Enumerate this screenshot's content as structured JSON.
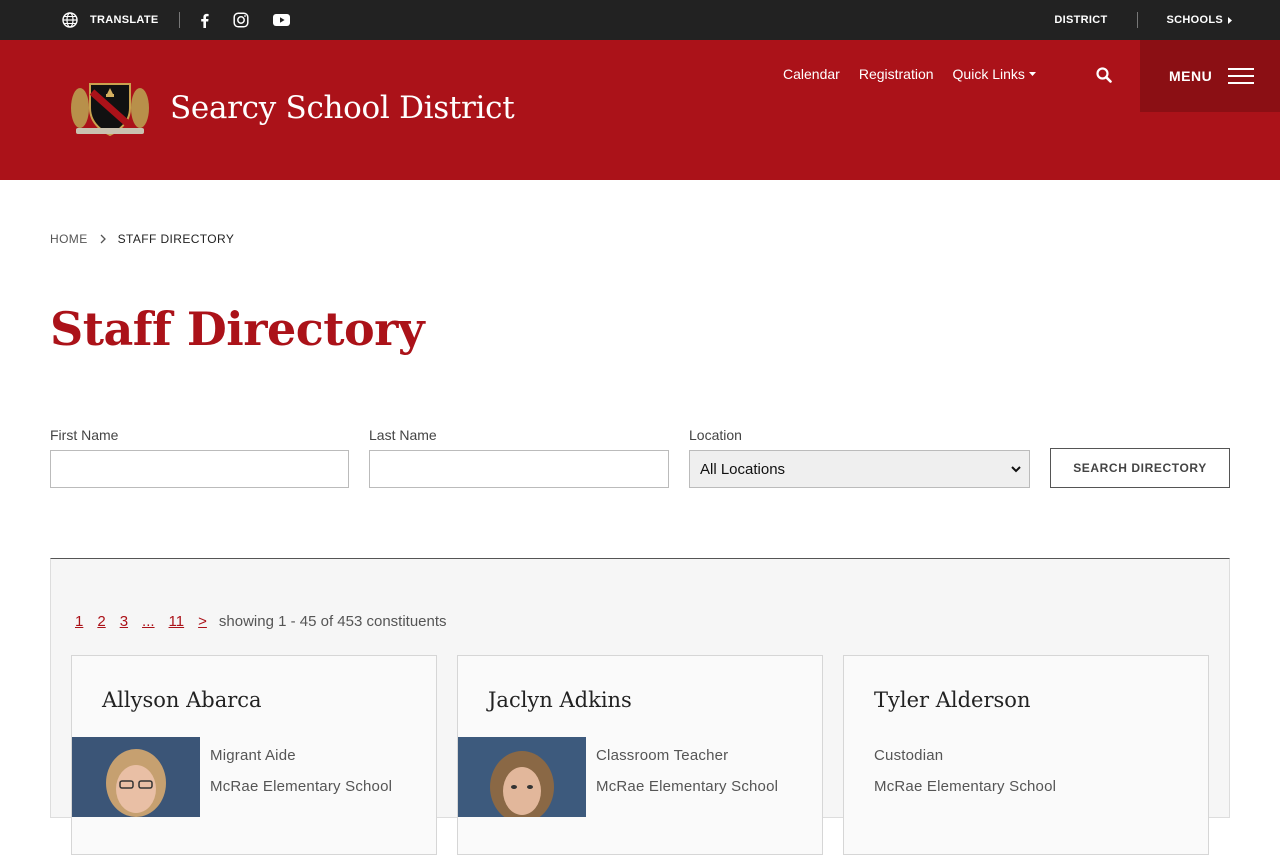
{
  "topbar": {
    "translate_label": "TRANSLATE",
    "district_label": "DISTRICT",
    "schools_label": "SCHOOLS"
  },
  "header": {
    "site_title": "Searcy School District",
    "nav": {
      "calendar": "Calendar",
      "registration": "Registration",
      "quick_links": "Quick Links"
    },
    "menu_label": "MENU"
  },
  "breadcrumb": {
    "home": "HOME",
    "current": "STAFF DIRECTORY"
  },
  "page_title": "Staff Directory",
  "search_form": {
    "first_name_label": "First Name",
    "last_name_label": "Last Name",
    "location_label": "Location",
    "location_selected": "All Locations",
    "submit_label": "SEARCH DIRECTORY"
  },
  "pagination": {
    "pages": [
      "1",
      "2",
      "3",
      "...",
      "11",
      ">"
    ],
    "showing": "showing 1 - 45 of 453 constituents"
  },
  "staff": [
    {
      "name": "Allyson Abarca",
      "title": "Migrant Aide",
      "school": "McRae Elementary School",
      "has_photo": true
    },
    {
      "name": "Jaclyn Adkins",
      "title": "Classroom Teacher",
      "school": "McRae Elementary School",
      "has_photo": true
    },
    {
      "name": "Tyler Alderson",
      "title": "Custodian",
      "school": "McRae Elementary School",
      "has_photo": false
    }
  ],
  "colors": {
    "brand_red": "#ab1219",
    "menu_dark_red": "#8b0f14",
    "topbar": "#222222"
  }
}
